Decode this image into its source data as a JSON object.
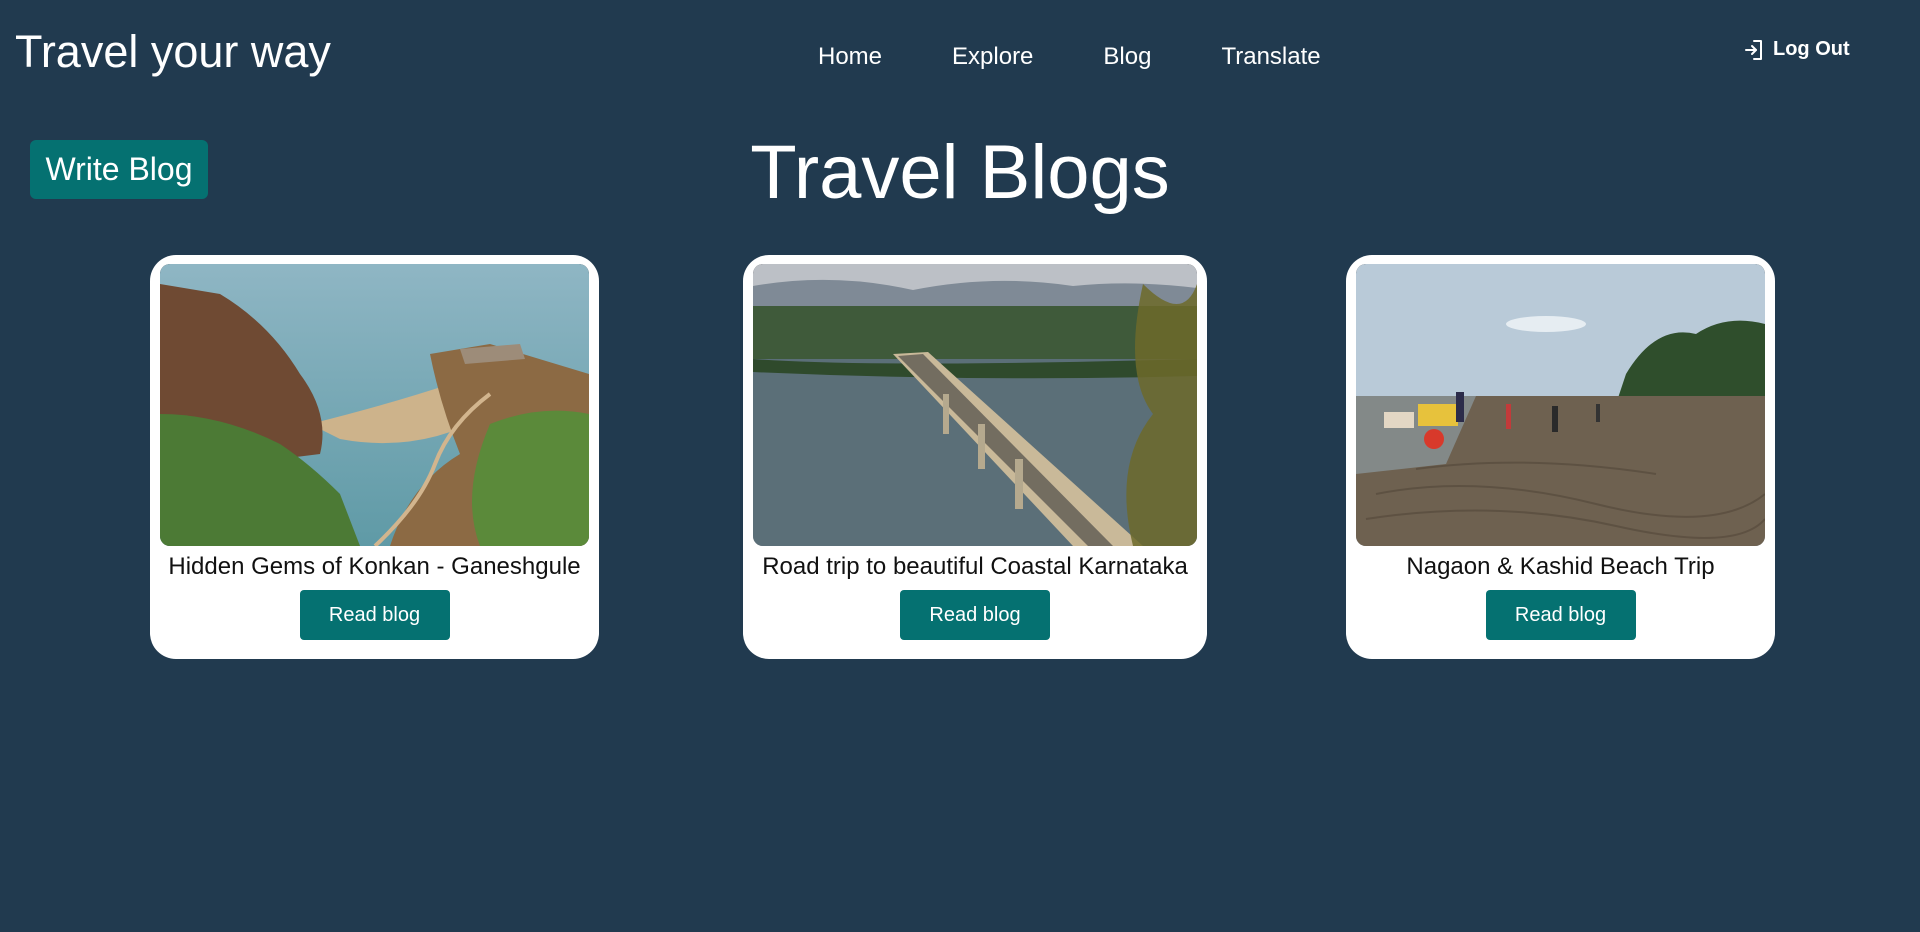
{
  "header": {
    "brand": "Travel your way",
    "nav": [
      "Home",
      "Explore",
      "Blog",
      "Translate"
    ],
    "logout_label": "Log Out",
    "logout_icon": "logout-arrow-icon"
  },
  "main": {
    "write_button_label": "Write Blog",
    "title": "Travel Blogs",
    "cards": [
      {
        "title": "Hidden Gems of Konkan - Ganeshgule",
        "button_label": "Read blog",
        "image": "coastal cliff and beach photo"
      },
      {
        "title": "Road trip to beautiful Coastal Karnataka",
        "button_label": "Read blog",
        "image": "bridge over river photo"
      },
      {
        "title": "Nagaon & Kashid Beach Trip",
        "button_label": "Read blog",
        "image": "beach with horse cart photo"
      }
    ]
  },
  "colors": {
    "background": "#213a4f",
    "accent": "#057171",
    "card": "#ffffff"
  }
}
